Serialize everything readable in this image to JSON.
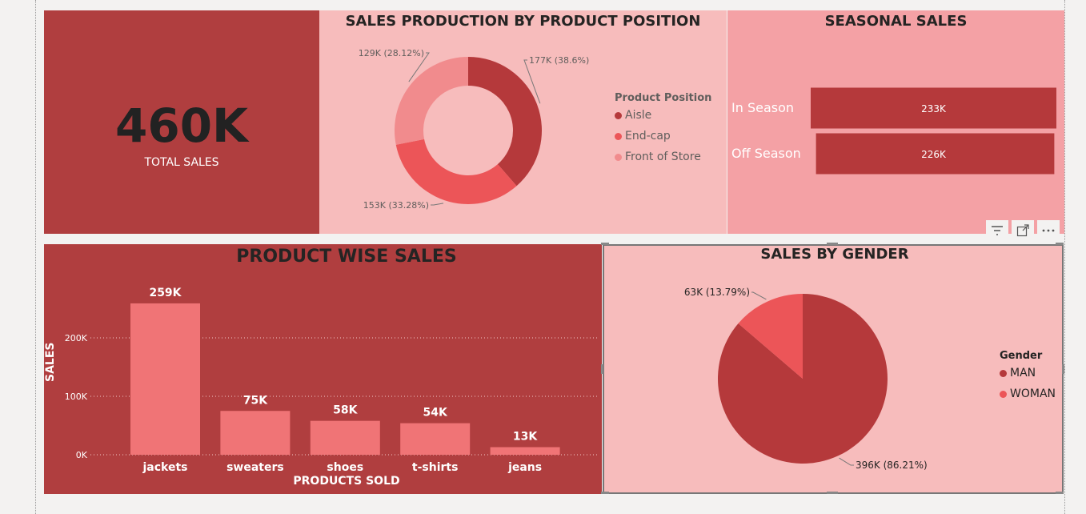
{
  "kpi": {
    "value": "460K",
    "label": "TOTAL SALES"
  },
  "donut": {
    "title": "SALES PRODUCTION BY PRODUCT POSITION",
    "legend_title": "Product Position",
    "colors": [
      "#b5393b",
      "#ec5558",
      "#f18b8d"
    ],
    "chart_data": {
      "type": "pie",
      "variant": "donut",
      "labels": [
        "Aisle",
        "End-cap",
        "Front of Store"
      ],
      "values": [
        177,
        153,
        129
      ],
      "data_labels": [
        "177K (38.6%)",
        "153K (33.28%)",
        "129K (28.12%)"
      ],
      "legend_position": "right"
    }
  },
  "seasonal": {
    "title": "SEASONAL SALES",
    "bar_color": "#b5393b",
    "chart_data": {
      "type": "bar",
      "orientation": "horizontal",
      "categories": [
        "In Season",
        "Off Season"
      ],
      "values": [
        233,
        226
      ],
      "data_labels": [
        "233K",
        "226K"
      ]
    }
  },
  "product": {
    "title": "PRODUCT WISE SALES",
    "bar_color": "#f07476",
    "chart_data": {
      "type": "bar",
      "categories": [
        "jackets",
        "sweaters",
        "shoes",
        "t-shirts",
        "jeans"
      ],
      "values": [
        259,
        75,
        58,
        54,
        13
      ],
      "data_labels": [
        "259K",
        "75K",
        "58K",
        "54K",
        "13K"
      ],
      "xlabel": "PRODUCTS SOLD",
      "ylabel": "SALES",
      "ylim": [
        0,
        259
      ],
      "yticks": [
        0,
        100,
        200
      ],
      "ytick_labels": [
        "0K",
        "100K",
        "200K"
      ],
      "grid": true
    }
  },
  "gender": {
    "title": "SALES BY GENDER",
    "legend_title": "Gender",
    "colors": [
      "#b5393b",
      "#ec5558"
    ],
    "chart_data": {
      "type": "pie",
      "labels": [
        "MAN",
        "WOMAN"
      ],
      "values": [
        396,
        63
      ],
      "data_labels": [
        "396K (86.21%)",
        "63K (13.79%)"
      ],
      "legend_position": "right"
    }
  },
  "toolbar": {
    "filter_icon": "filter-icon",
    "focus_icon": "focus-mode-icon",
    "more_icon": "more-options-icon"
  }
}
